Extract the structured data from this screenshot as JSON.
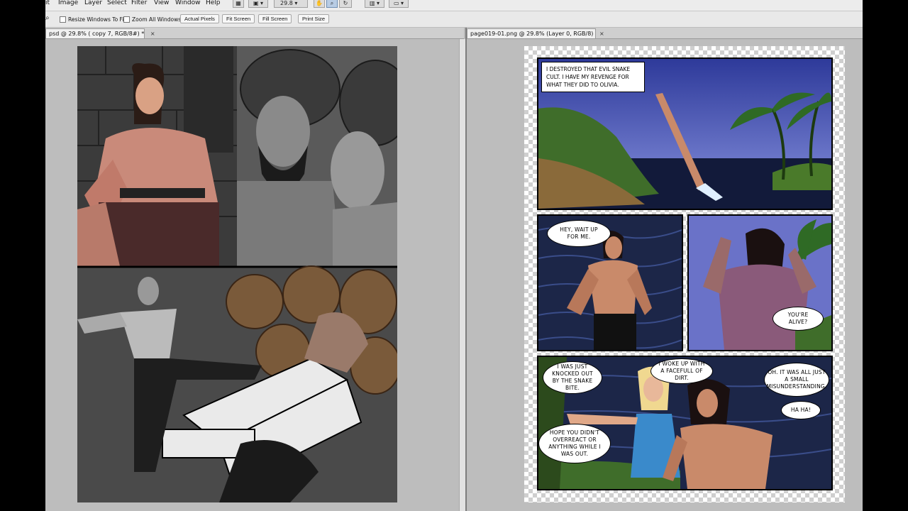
{
  "menubar": {
    "items": [
      "it",
      "Image",
      "Layer",
      "Select",
      "Filter",
      "View",
      "Window",
      "Help"
    ],
    "zoom_value": "29.8"
  },
  "options": {
    "resize_windows": "Resize Windows To Fit",
    "zoom_all": "Zoom All Windows",
    "actual_pixels": "Actual Pixels",
    "fit_screen": "Fit Screen",
    "fill_screen": "Fill Screen",
    "print_size": "Print Size"
  },
  "documents": {
    "left_tab": "psd @ 29.8% ( copy 7, RGB/8#) *",
    "right_tab": "page019-01.png @ 29.8% (Layer 0, RGB/8)",
    "close_glyph": "×"
  },
  "comic": {
    "caption": "I destroyed that evil snake cult. I have my revenge for what they did to Olivia.",
    "bubbles": [
      "Hey, wait up for me.",
      "You're alive?",
      "I was just knocked out by the snake bite.",
      "I woke up with a facefull of dirt.",
      "Oh. It was all just a small misunderstanding.",
      "Ha ha!",
      "Hope you didn't overreact or anything while I was out."
    ]
  },
  "colors": {
    "night_sky": "#3d4aa3",
    "water": "#1c2648",
    "jungle_green": "#3f6d2a",
    "skin": "#c98a6a"
  }
}
